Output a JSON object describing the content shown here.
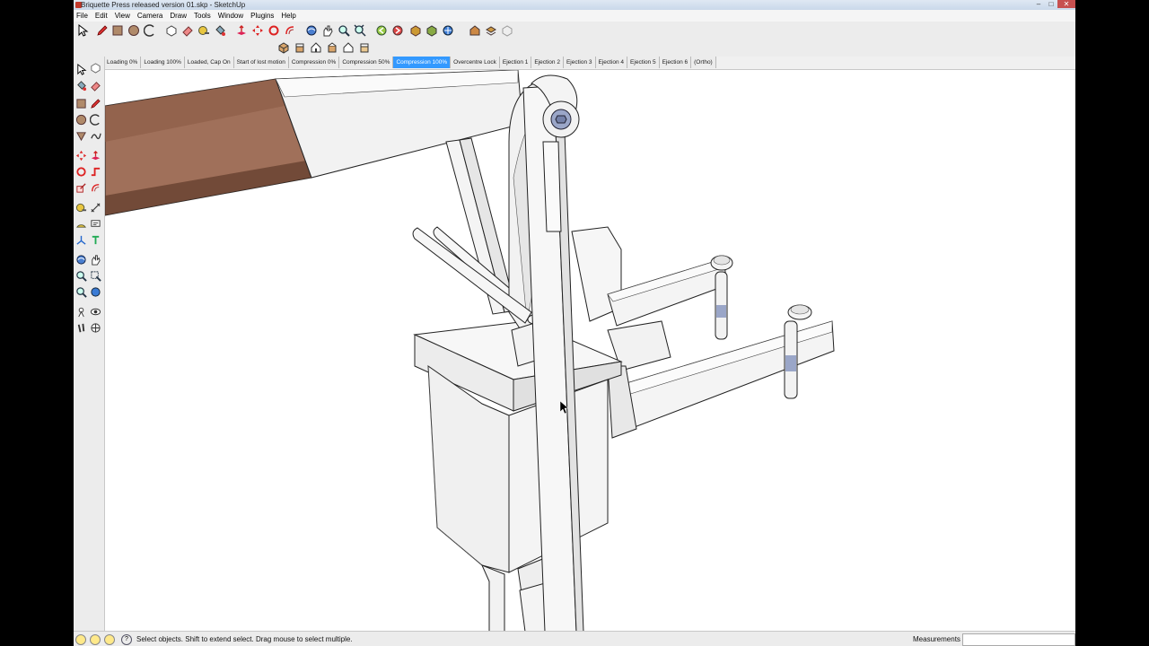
{
  "window": {
    "title": "Briquette Press released version 01.skp - SketchUp"
  },
  "menu": [
    "File",
    "Edit",
    "View",
    "Camera",
    "Draw",
    "Tools",
    "Window",
    "Plugins",
    "Help"
  ],
  "scenes": [
    "Loading 0%",
    "Loading 100%",
    "Loaded, Cap On",
    "Start of lost motion",
    "Compression 0%",
    "Compression 50%",
    "Compression 100%",
    "Overcentre Lock",
    "Ejection 1",
    "Ejection 2",
    "Ejection 3",
    "Ejection 4",
    "Ejection 5",
    "Ejection 6",
    "(Ortho)"
  ],
  "active_scene": "Compression 100%",
  "status": {
    "hint": "Select objects. Shift to extend select. Drag mouse to select multiple.",
    "measurements_label": "Measurements",
    "measurements_value": ""
  },
  "toolbar_main_icons": [
    "select-icon",
    "pencil-icon",
    "rectangle-icon",
    "circle-icon",
    "arc-icon",
    "make-component-icon",
    "eraser-icon",
    "tape-measure-icon",
    "paint-bucket-icon",
    "push-pull-icon",
    "move-icon",
    "rotate-icon",
    "offset-icon",
    "orbit-icon",
    "pan-icon",
    "zoom-icon",
    "zoom-extents-icon",
    "previous-view-icon",
    "next-view-icon",
    "get-models-icon",
    "share-model-icon",
    "component-icon",
    "warehouse-icon",
    "layer-icon"
  ],
  "toolbar_view_icons": [
    "iso-view-icon",
    "top-view-icon",
    "front-view-icon",
    "right-view-icon",
    "back-view-icon",
    "left-view-icon"
  ],
  "colors": {
    "accent": "#3399ff",
    "handle_wood": "#a0705a",
    "bolt": "#9aa6c8",
    "part": "#f2f2f2"
  }
}
